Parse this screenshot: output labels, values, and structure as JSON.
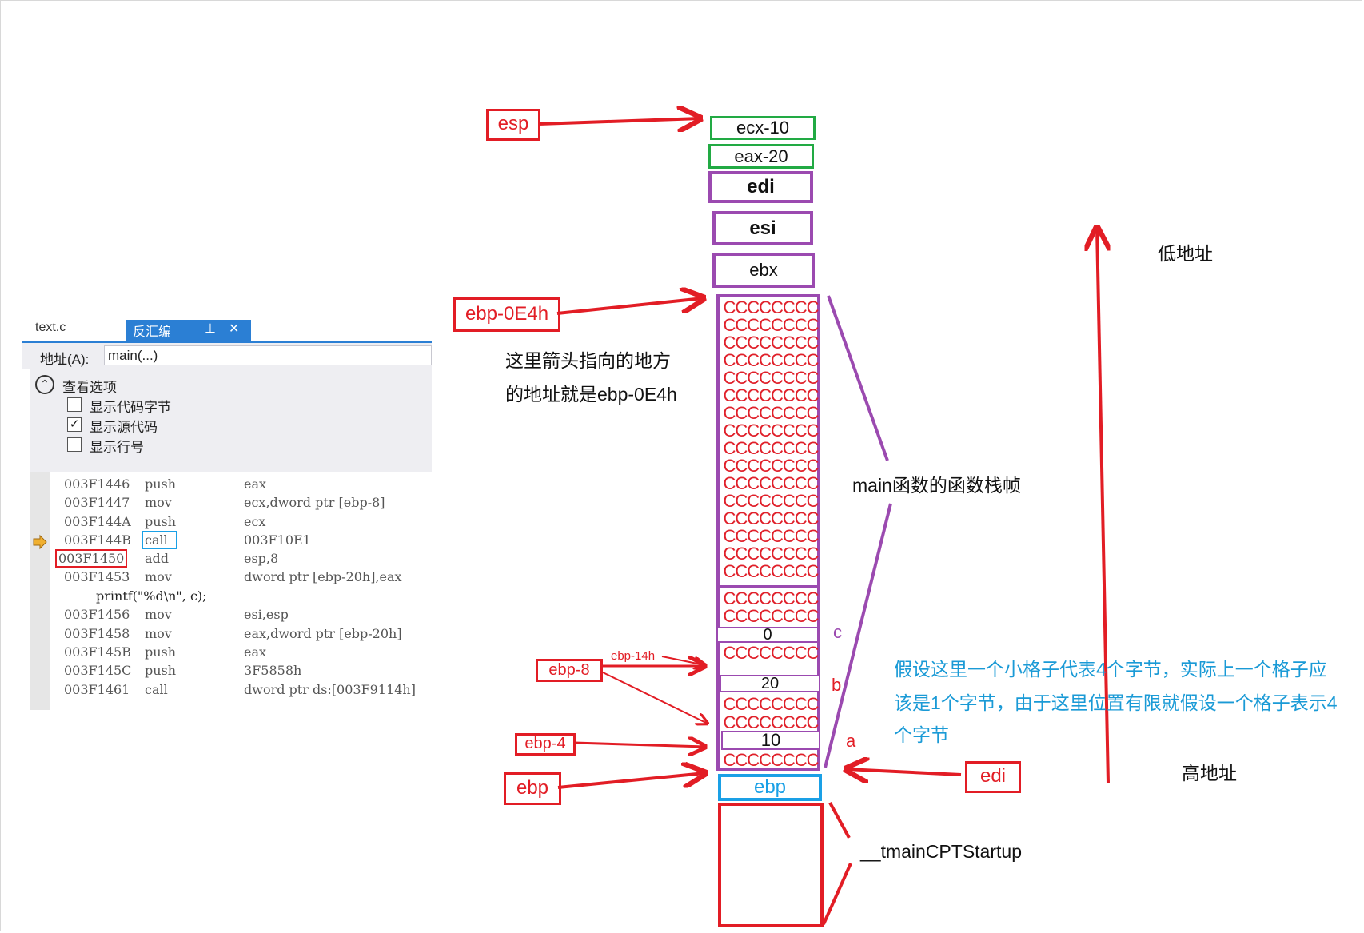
{
  "debugger": {
    "tabs": {
      "file": "text.c",
      "active": "反汇编",
      "pin": "⊥",
      "close": "✕"
    },
    "address": {
      "label": "地址(A):",
      "value": "main(...)"
    },
    "options": {
      "title": "查看选项",
      "items": [
        {
          "label": "显示代码字节",
          "checked": false
        },
        {
          "label": "显示源代码",
          "checked": true
        },
        {
          "label": "显示行号",
          "checked": false
        }
      ]
    },
    "code": [
      {
        "addr": "003F1446",
        "op": "push",
        "arg": "eax"
      },
      {
        "addr": "003F1447",
        "op": "mov",
        "arg": "ecx,dword ptr [ebp-8]"
      },
      {
        "addr": "003F144A",
        "op": "push",
        "arg": "ecx"
      },
      {
        "addr": "003F144B",
        "op": "call",
        "arg": "003F10E1"
      },
      {
        "addr": "003F1450",
        "op": "add",
        "arg": "esp,8"
      },
      {
        "addr": "003F1453",
        "op": "mov",
        "arg": "dword ptr [ebp-20h],eax"
      },
      {
        "addr": "003F1456",
        "op": "mov",
        "arg": "esi,esp"
      },
      {
        "addr": "003F1458",
        "op": "mov",
        "arg": "eax,dword ptr [ebp-20h]"
      },
      {
        "addr": "003F145B",
        "op": "push",
        "arg": "eax"
      },
      {
        "addr": "003F145C",
        "op": "push",
        "arg": "3F5858h"
      },
      {
        "addr": "003F1461",
        "op": "call",
        "arg": "dword ptr ds:[003F9114h]"
      }
    ],
    "source_line": "printf(\"%d\\n\", c);"
  },
  "stack": {
    "saved_regs": [
      "ecx-10",
      "eax-20",
      "edi",
      "esi",
      "ebx"
    ],
    "fill": "CCCCCCCC",
    "var_c": "0",
    "var_b": "20",
    "var_a": "10",
    "base": "ebp"
  },
  "labels": {
    "esp": "esp",
    "ebp_0e4h": "ebp-0E4h",
    "ebp_14h": "ebp-14h",
    "ebp_8": "ebp-8",
    "ebp_4": "ebp-4",
    "ebp": "ebp",
    "edi": "edi",
    "c": "c",
    "b": "b",
    "a": "a"
  },
  "annotations": {
    "arrow_note_line1": "这里箭头指向的地方",
    "arrow_note_line2": "的地址就是ebp-0E4h",
    "frame_caption": "main函数的函数栈帧",
    "caller_caption": "__tmainCPTStartup",
    "low_address": "低地址",
    "high_address": "高地址",
    "cell_note_line1": "假设这里一个小格子代表4个字节，实际上一个格子应",
    "cell_note_line2": "该是1个字节，由于这里位置有限就假设一个格子表示4",
    "cell_note_line3": "个字节"
  },
  "colors": {
    "red": "#e21d25",
    "green": "#22aa44",
    "purple": "#9b4ab0",
    "blue": "#1aa0e6",
    "note_blue": "#1a9ad6"
  }
}
